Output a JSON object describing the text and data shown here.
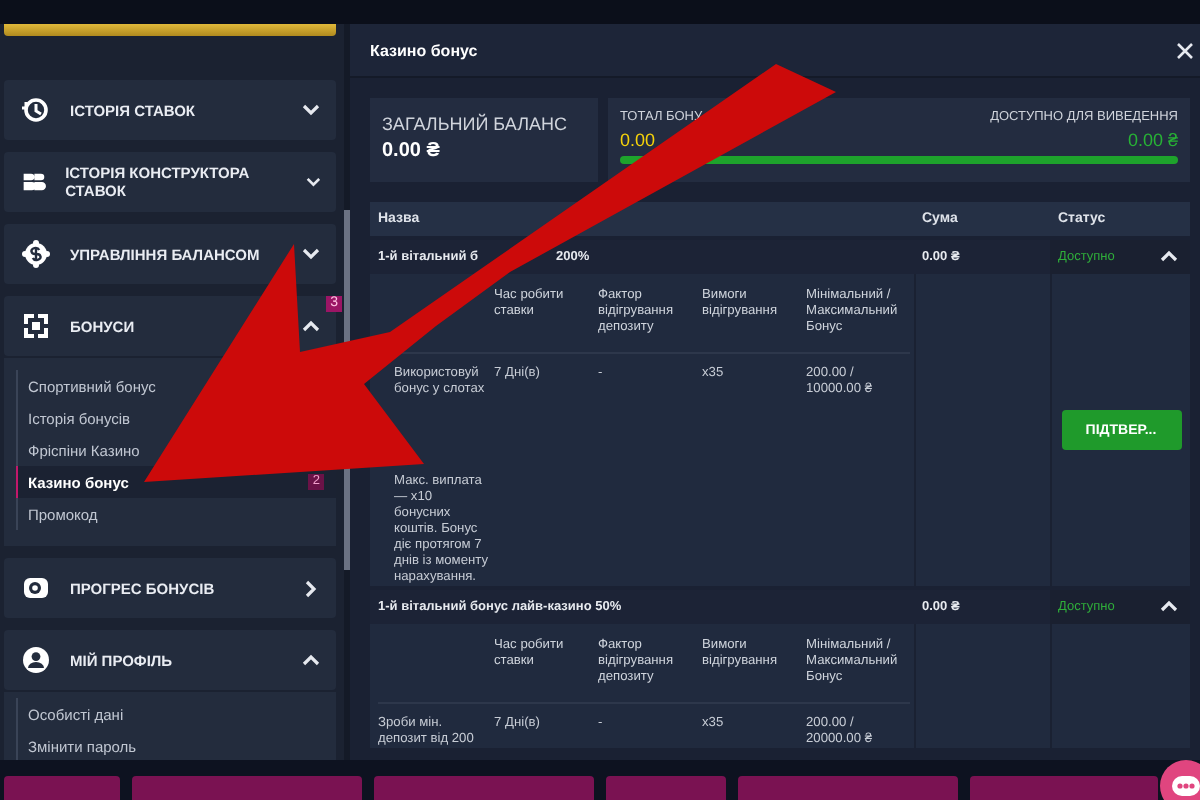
{
  "sidebar": {
    "sections": [
      {
        "kind": "history",
        "label": "ІСТОРІЯ СТАВОК",
        "expanded": false
      },
      {
        "kind": "builder",
        "label": "ІСТОРІЯ КОНСТРУКТОРА СТАВОК",
        "expanded": false
      },
      {
        "kind": "balance",
        "label": "УПРАВЛІННЯ БАЛАНСОМ",
        "expanded": false
      },
      {
        "kind": "bonus",
        "label": "БОНУСИ",
        "expanded": true,
        "badge": "3",
        "children": [
          {
            "label": "Спортивний бонус",
            "selected": false
          },
          {
            "label": "Історія бонусів",
            "selected": false
          },
          {
            "label": "Фріспіни Казино",
            "selected": false
          },
          {
            "label": "Казино бонус",
            "selected": true,
            "badge": "2"
          },
          {
            "label": "Промокод",
            "selected": false
          }
        ]
      },
      {
        "kind": "progress",
        "label": "ПРОГРЕС БОНУСІВ",
        "expanded": false,
        "link": true
      },
      {
        "kind": "profile",
        "label": "МІЙ ПРОФІЛЬ",
        "expanded": true,
        "children": [
          {
            "label": "Особисті дані",
            "selected": false
          },
          {
            "label": "Змінити пароль",
            "selected": false
          }
        ]
      }
    ]
  },
  "modal": {
    "title": "Казино бонус",
    "balance": {
      "label": "ЗАГАЛЬНИЙ БАЛАНС",
      "value": "0.00 ₴"
    },
    "totals": {
      "label": "ТОТАЛ БОНУ",
      "value": "0.00",
      "available_label": "ДОСТУПНО ДЛЯ ВИВЕДЕННЯ",
      "available_value": "0.00 ₴",
      "level": 1
    },
    "table": {
      "columns": [
        "Назва",
        "Сума",
        "Статус"
      ],
      "rows": [
        {
          "name_parts": [
            "1-й вітальний б",
            "200%"
          ],
          "amount": "0.00 ₴",
          "status": "Доступно",
          "expanded": true,
          "detail_columns": [
            "Час робити ставки",
            "Фактор відігрування депозиту",
            "Вимоги відігрування",
            "Мінімальний / Максимальний Бонус"
          ],
          "description_parts": [
            "Використовуй бонус у слотах",
            "Макс. виплата — x10 бонусних коштів. Бонус діє протягом 7 днів із моменту нарахування."
          ],
          "values": [
            "7 Дні(в)",
            "-",
            "x35",
            "200.00 / 10000.00 ₴"
          ],
          "button": "ПІДТВЕР..."
        },
        {
          "name_parts": [
            "1-й вітальний бонус лайв-казино 50%"
          ],
          "amount": "0.00 ₴",
          "status": "Доступно",
          "expanded": true,
          "detail_columns": [
            "Час робити ставки",
            "Фактор відігрування депозиту",
            "Вимоги відігрування",
            "Мінімальний / Максимальний Бонус"
          ],
          "description_parts": [
            "Зроби мін. депозит від 200"
          ],
          "values": [
            "7 Дні(в)",
            "-",
            "x35",
            "200.00 / 20000.00 ₴"
          ]
        }
      ]
    }
  }
}
